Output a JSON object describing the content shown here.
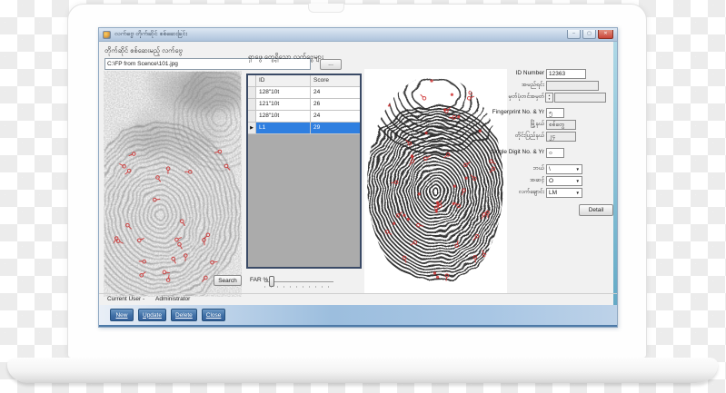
{
  "window": {
    "title": "လက်ဗွေ တိုက်ဆိုင် စစ်ဆေးခြင်း"
  },
  "icons": {
    "minimize": "–",
    "maximize": "▢",
    "close": "✕",
    "browse": "...",
    "dropdown": "▼",
    "selected_row_marker": "▶",
    "spinner_up": "▲",
    "spinner_down": "▼"
  },
  "probe": {
    "label": "တိုက်ဆိုင် စစ်ဆေးမည့် လက်ဗွေ",
    "path_value": "C:\\FP from Scence\\101.jpg"
  },
  "results": {
    "label": "ရှာဖွေ တွေ့ရှိသော လက်ဗွေများ",
    "table": {
      "columns": {
        "id": "ID",
        "score": "Score"
      },
      "rows": [
        {
          "id": "128\"10t",
          "score": "24"
        },
        {
          "id": "121\"10t",
          "score": "26"
        },
        {
          "id": "128\"10t",
          "score": "24"
        },
        {
          "id": "L1",
          "score": "29"
        }
      ],
      "selected_row_index": 3
    },
    "search_label": "Search",
    "far_slider": {
      "label": "FAR %",
      "thumb_position_percent": 10
    }
  },
  "details": {
    "id_number": {
      "label": "ID Number",
      "value": "12363"
    },
    "name": {
      "label": "အမည်ရင်း",
      "value": ""
    },
    "reg_no": {
      "label": "မှတ်ပုံတင်အမှတ်",
      "value": ""
    },
    "fp_no": {
      "label": "Fingerprint No. & Yr",
      "value": "၅"
    },
    "township": {
      "label": "မြို့နယ်",
      "value": "စစ်တွေ"
    },
    "state": {
      "label": "တိုင်းပြည်နယ်",
      "value": "၂၄"
    },
    "single_digit": {
      "label": "Single Digit No. & Yr",
      "value": "၀"
    },
    "hand": {
      "label": "ဘယ်",
      "value": "\\"
    },
    "grade": {
      "label": "အဆင့်",
      "value": "O"
    },
    "finger": {
      "label": "လက်ချောင်း",
      "value": "LM"
    },
    "detail_button": "Detail"
  },
  "statusbar": {
    "current_user_label": "Current User -",
    "current_user_value": "Administrator"
  },
  "actions": {
    "new": "New",
    "update": "Update",
    "delete": "Delete",
    "close": "Close"
  },
  "colors": {
    "titlebar_from": "#dde7f3",
    "titlebar_to": "#aec3dc",
    "selection_blue": "#2f7fe0",
    "action_button_blue": "#3f6fa6",
    "bottom_strip_blue": "#9cbede",
    "window_border_teal": "#64aac6",
    "close_red": "#c9473a",
    "minutiae_red": "#cc2b2b"
  }
}
